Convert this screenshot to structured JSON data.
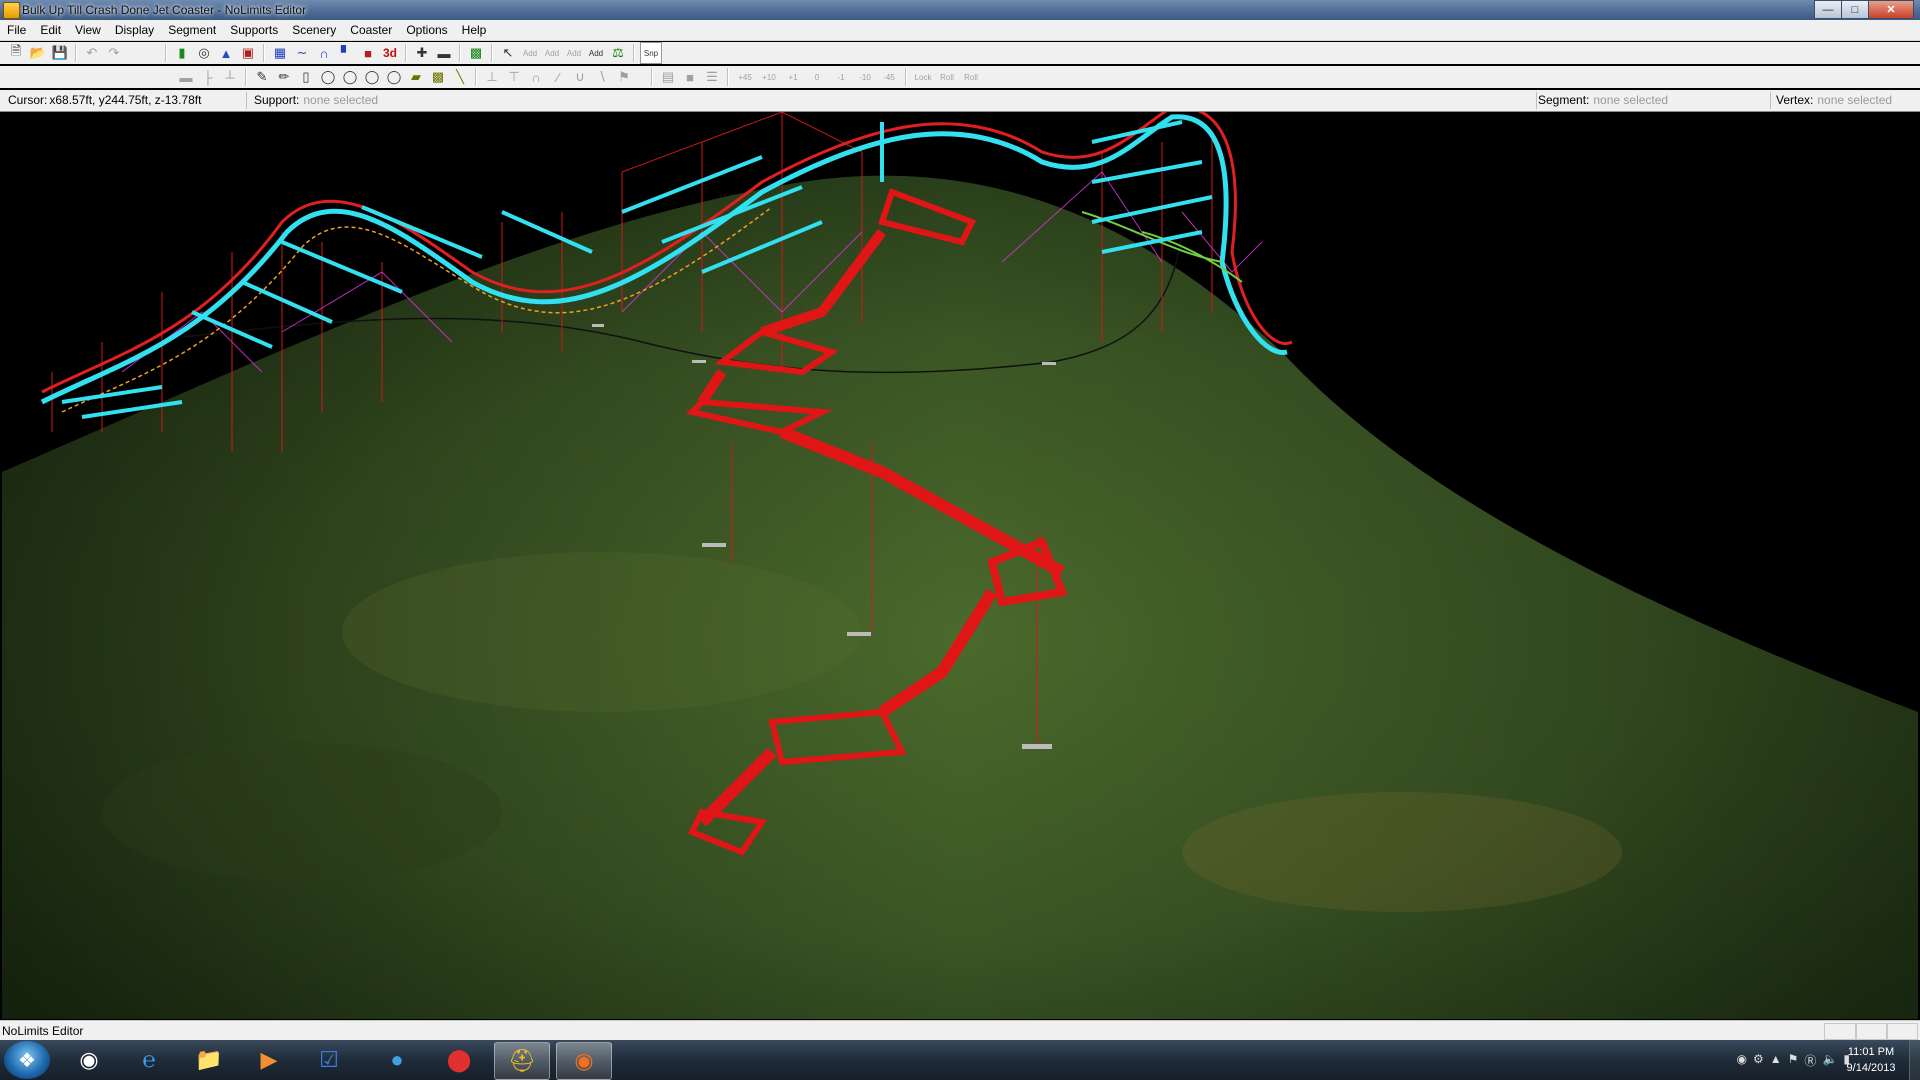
{
  "window": {
    "title": "Bulk Up Till Crash Done Jet Coaster - NoLimits Editor"
  },
  "menu": [
    "File",
    "Edit",
    "View",
    "Display",
    "Segment",
    "Supports",
    "Scenery",
    "Coaster",
    "Options",
    "Help"
  ],
  "toolbar": {
    "three_d_label": "3d",
    "snap_label": "Snp",
    "add_label": "Add",
    "angles": [
      "+45",
      "+10",
      "+1",
      "0",
      "-1",
      "-10",
      "-45"
    ],
    "lock_label": "Lock",
    "roll_label": "Roll"
  },
  "status": {
    "cursor_label": "Cursor:",
    "cursor_value": "x68.57ft, y244.75ft, z-13.78ft",
    "support_label": "Support:",
    "support_value": "none selected",
    "segment_label": "Segment:",
    "segment_value": "none selected",
    "vertex_label": "Vertex:",
    "vertex_value": "none selected"
  },
  "bottom_status": "NoLimits Editor",
  "taskbar": {
    "apps": [
      "hp-icon",
      "internet-explorer-icon",
      "file-explorer-icon",
      "media-player-icon",
      "tasks-icon",
      "blue-orb-icon",
      "red-app-icon",
      "nolimits-icon",
      "firefox-icon"
    ],
    "clock_time": "11:01 PM",
    "clock_date": "9/14/2013"
  },
  "colors": {
    "track": "#33e0f0",
    "supports": "#ff1a1a",
    "terrain": "#3f5a26",
    "magenta": "#e040e0"
  }
}
